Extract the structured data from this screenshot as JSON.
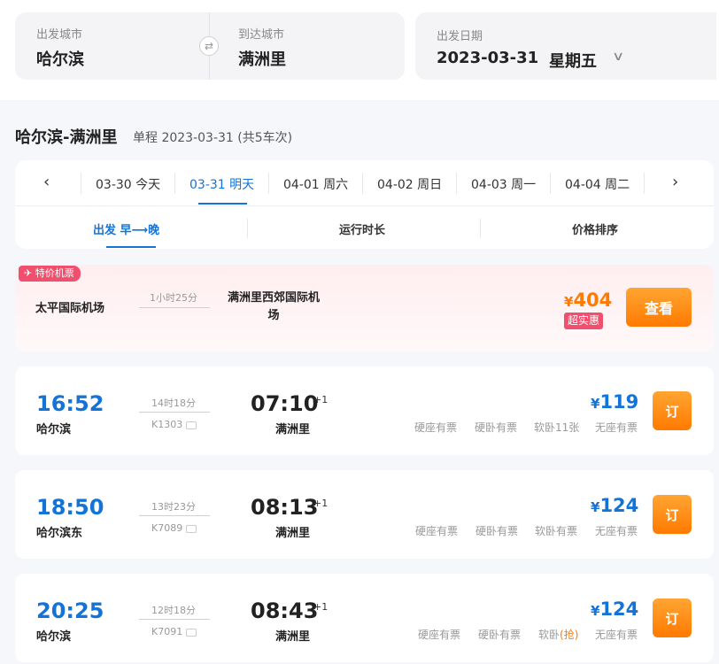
{
  "search": {
    "from_label": "出发城市",
    "from_city": "哈尔滨",
    "swap_icon": "⇄",
    "to_label": "到达城市",
    "to_city": "满洲里",
    "date_label": "出发日期",
    "date": "2023-03-31",
    "weekday": "星期五",
    "chevron": "∨"
  },
  "route": {
    "title": "哈尔滨-满洲里",
    "subtitle": "单程 2023-03-31 (共5车次)"
  },
  "datebar": {
    "prev": "‹",
    "next": "›",
    "days": [
      {
        "label": "03-30 今天"
      },
      {
        "label": "03-31 明天",
        "active": true
      },
      {
        "label": "04-01 周六"
      },
      {
        "label": "04-02 周日"
      },
      {
        "label": "04-03 周一"
      },
      {
        "label": "04-04 周二"
      }
    ]
  },
  "sort": {
    "depart": "出发 早⟶晚",
    "duration": "运行时长",
    "price": "价格排序"
  },
  "flight": {
    "tag": "✈ 特价机票",
    "from": "太平国际机场",
    "duration": "1小时25分",
    "to": "满洲里西郊国际机场",
    "currency": "¥",
    "price": "404",
    "badge": "超实惠",
    "button": "查看"
  },
  "trains": [
    {
      "depart_time": "16:52",
      "from": "哈尔滨",
      "duration": "14时18分",
      "train_no": "K1303",
      "arrive_time": "07:10",
      "day_offset": "+1",
      "to": "满洲里",
      "currency": "¥",
      "price": "119",
      "seats": [
        "硬座有票",
        "硬卧有票",
        "软卧11张",
        "无座有票"
      ],
      "button": "订"
    },
    {
      "depart_time": "18:50",
      "from": "哈尔滨东",
      "duration": "13时23分",
      "train_no": "K7089",
      "arrive_time": "08:13",
      "day_offset": "+1",
      "to": "满洲里",
      "currency": "¥",
      "price": "124",
      "seats": [
        "硬座有票",
        "硬卧有票",
        "软卧有票",
        "无座有票"
      ],
      "button": "订"
    },
    {
      "depart_time": "20:25",
      "from": "哈尔滨",
      "duration": "12时18分",
      "train_no": "K7091",
      "arrive_time": "08:43",
      "day_offset": "+1",
      "to": "满洲里",
      "currency": "¥",
      "price": "124",
      "seats": [
        "硬座有票",
        "硬卧有票",
        "软卧",
        "无座有票"
      ],
      "seat3_extra": "(抢)",
      "button": "订"
    }
  ],
  "colors": {
    "accent": "#1473d7",
    "orange": "#ff7a00",
    "pink": "#f0506e"
  }
}
